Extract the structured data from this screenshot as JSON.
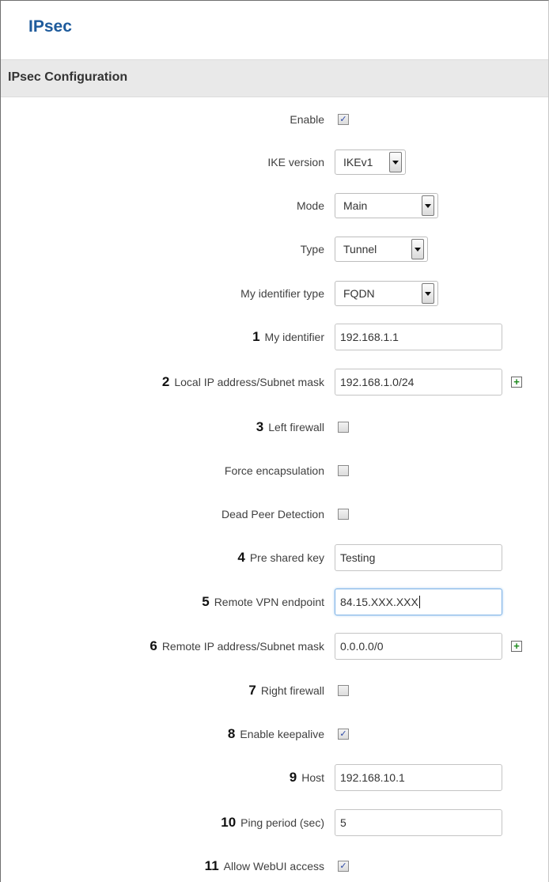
{
  "page": {
    "title": "IPsec",
    "section_title": "IPsec Configuration"
  },
  "fields": {
    "enable": {
      "label": "Enable",
      "checked": true
    },
    "ike_version": {
      "label": "IKE version",
      "value": "IKEv1"
    },
    "mode": {
      "label": "Mode",
      "value": "Main"
    },
    "type": {
      "label": "Type",
      "value": "Tunnel"
    },
    "my_identifier_type": {
      "label": "My identifier type",
      "value": "FQDN"
    },
    "my_identifier": {
      "num": "1",
      "label": "My identifier",
      "value": "192.168.1.1"
    },
    "local_ip": {
      "num": "2",
      "label": "Local IP address/Subnet mask",
      "value": "192.168.1.0/24"
    },
    "left_firewall": {
      "num": "3",
      "label": "Left firewall",
      "checked": false
    },
    "force_encapsulation": {
      "label": "Force encapsulation",
      "checked": false
    },
    "dead_peer_detection": {
      "label": "Dead Peer Detection",
      "checked": false
    },
    "pre_shared_key": {
      "num": "4",
      "label": "Pre shared key",
      "value": "Testing"
    },
    "remote_vpn_endpoint": {
      "num": "5",
      "label": "Remote VPN endpoint",
      "value": "84.15.XXX.XXX"
    },
    "remote_ip": {
      "num": "6",
      "label": "Remote IP address/Subnet mask",
      "value": "0.0.0.0/0"
    },
    "right_firewall": {
      "num": "7",
      "label": "Right firewall",
      "checked": false
    },
    "enable_keepalive": {
      "num": "8",
      "label": "Enable keepalive",
      "checked": true
    },
    "host": {
      "num": "9",
      "label": "Host",
      "value": "192.168.10.1"
    },
    "ping_period": {
      "num": "10",
      "label": "Ping period (sec)",
      "value": "5"
    },
    "allow_webui_access": {
      "num": "11",
      "label": "Allow WebUI access",
      "checked": true
    }
  },
  "symbols": {
    "check": "✓",
    "plus": "+"
  },
  "colors": {
    "title": "#1e5b9c",
    "section_bg": "#e9e9e9",
    "checkmark": "#2b47a6",
    "add_icon": "#1c8a1c",
    "focus_border": "#7fb3e6"
  }
}
